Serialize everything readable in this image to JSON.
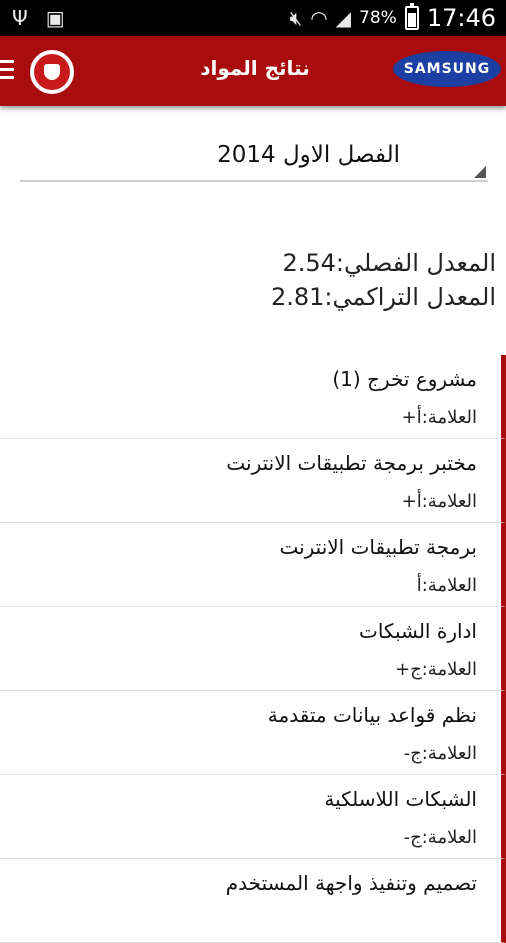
{
  "status_bar": {
    "icons_left": [
      "usb-icon",
      "image-icon"
    ],
    "icons_right": [
      "mute-icon",
      "wifi-icon",
      "signal-icon",
      "battery-icon"
    ],
    "battery": "78%",
    "time": "17:46"
  },
  "app_bar": {
    "brand": "SAMSUNG",
    "title": "نتائج المواد",
    "accent_color": "#a80c0c"
  },
  "semester": {
    "selected": "الفصل الاول 2014"
  },
  "gpa": {
    "semester_line": "المعدل الفصلي:2.54",
    "cumulative_line": "المعدل التراكمي:2.81"
  },
  "courses": [
    {
      "name": "مشروع تخرج (1)",
      "grade": "العلامة:أ+"
    },
    {
      "name": "مختبر برمجة تطبيقات الانترنت",
      "grade": "العلامة:أ+"
    },
    {
      "name": "برمجة تطبيقات الانترنت",
      "grade": "العلامة:أ"
    },
    {
      "name": "ادارة الشبكات",
      "grade": "العلامة:ج+"
    },
    {
      "name": "نظم قواعد بيانات متقدمة",
      "grade": "العلامة:ج-"
    },
    {
      "name": "الشبكات اللاسلكية",
      "grade": "العلامة:ج-"
    },
    {
      "name": "تصميم وتنفيذ واجهة المستخدم",
      "grade": ""
    }
  ]
}
